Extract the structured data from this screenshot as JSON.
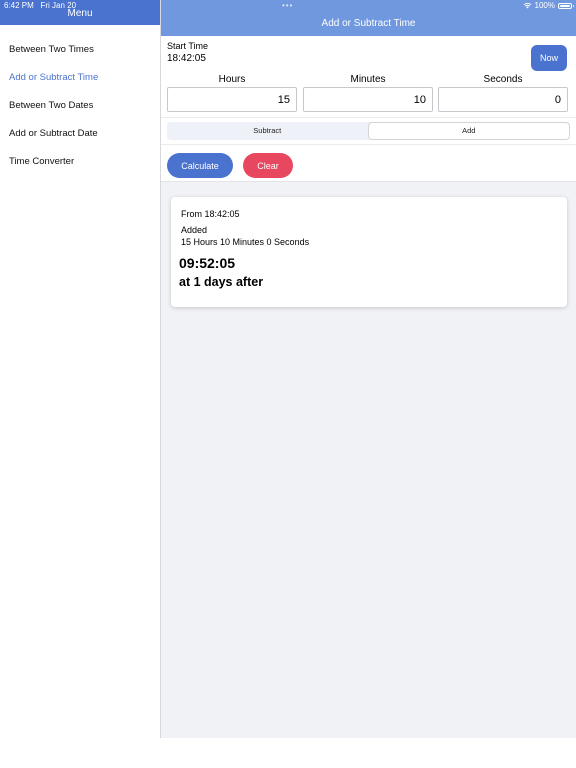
{
  "status": {
    "time": "6:42 PM",
    "date": "Fri Jan 20",
    "battery": "100%",
    "dots": "•••"
  },
  "sidebar": {
    "title": "Menu",
    "items": [
      {
        "label": "Between Two Times"
      },
      {
        "label": "Add or Subtract Time"
      },
      {
        "label": "Between Two Dates"
      },
      {
        "label": "Add or Subtract Date"
      },
      {
        "label": "Time Converter"
      }
    ]
  },
  "main": {
    "title": "Add or Subtract Time",
    "start_label": "Start Time",
    "start_value": "18:42:05",
    "now_label": "Now",
    "columns": {
      "hours": "Hours",
      "minutes": "Minutes",
      "seconds": "Seconds"
    },
    "inputs": {
      "hours": "15",
      "minutes": "10",
      "seconds": "0"
    },
    "segment": {
      "subtract": "Subtract",
      "add": "Add",
      "selected": "Add"
    },
    "calculate_label": "Calculate",
    "clear_label": "Clear"
  },
  "result": {
    "from": "From 18:42:05",
    "added": "Added",
    "amount": "15 Hours 10 Minutes 0 Seconds",
    "time": "09:52:05",
    "days": "at 1 days after"
  },
  "colors": {
    "accent": "#4a72cf",
    "header": "#7098df",
    "clear": "#e8485f",
    "background": "#f1f2f6"
  }
}
